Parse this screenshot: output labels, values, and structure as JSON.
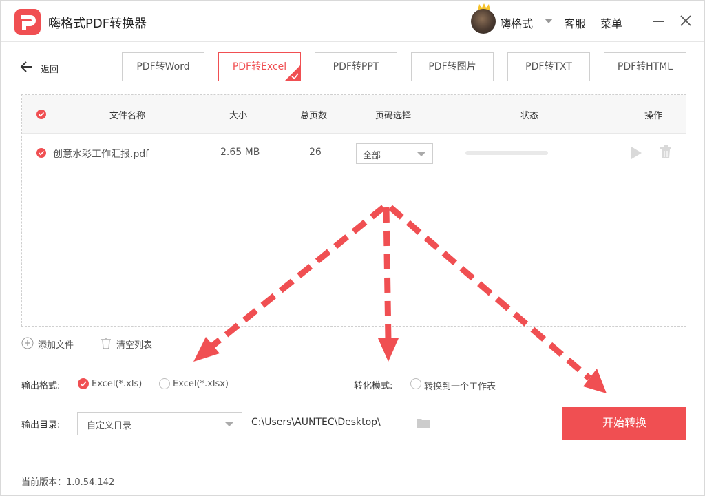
{
  "app": {
    "title": "嗨格式PDF转换器"
  },
  "header": {
    "user_name": "嗨格式",
    "service_label": "客服",
    "menu_label": "菜单"
  },
  "nav": {
    "back_label": "返回"
  },
  "tabs": [
    {
      "label": "PDF转Word",
      "active": false
    },
    {
      "label": "PDF转Excel",
      "active": true
    },
    {
      "label": "PDF转PPT",
      "active": false
    },
    {
      "label": "PDF转图片",
      "active": false
    },
    {
      "label": "PDF转TXT",
      "active": false
    },
    {
      "label": "PDF转HTML",
      "active": false
    }
  ],
  "table": {
    "headers": {
      "name": "文件名称",
      "size": "大小",
      "pages": "总页数",
      "page_select": "页码选择",
      "status": "状态",
      "action": "操作"
    },
    "rows": [
      {
        "name": "创意水彩工作汇报.pdf",
        "size": "2.65 MB",
        "pages": "26",
        "page_select": "全部",
        "progress": 0
      }
    ]
  },
  "actions": {
    "add_file": "添加文件",
    "clear_list": "清空列表"
  },
  "output_format": {
    "label": "输出格式:",
    "options": [
      {
        "label": "Excel(*.xls)",
        "selected": true
      },
      {
        "label": "Excel(*.xlsx)",
        "selected": false
      }
    ]
  },
  "convert_mode": {
    "label": "转化模式:",
    "option": "转换到一个工作表",
    "selected": false
  },
  "output_dir": {
    "label": "输出目录:",
    "select_value": "自定义目录",
    "path": "C:\\Users\\AUNTEC\\Desktop\\"
  },
  "start_button": "开始转换",
  "footer": {
    "version": "当前版本：1.0.54.142"
  },
  "colors": {
    "accent": "#f04f52",
    "annotation_arrow": "#f04f52"
  }
}
